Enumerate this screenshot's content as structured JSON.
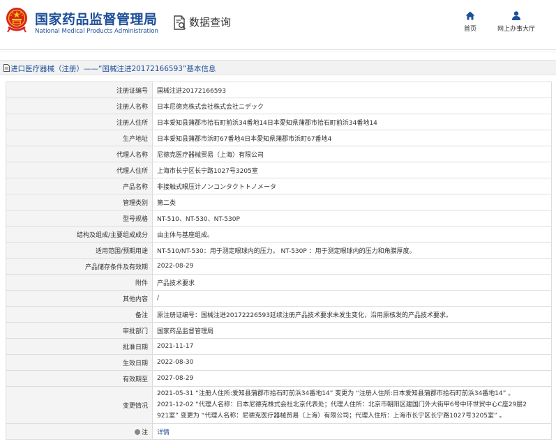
{
  "header": {
    "brand_cn": "国家药品监督管理局",
    "brand_en": "National Medical Products Administration",
    "query_title": "数据查询",
    "nav": [
      {
        "label": "首页",
        "icon": "home-icon"
      },
      {
        "label": "网上办事大厅",
        "icon": "person-icon"
      }
    ]
  },
  "page_title": "进口医疗器械（注册）——“国械注进20172166593”基本信息",
  "rows": [
    {
      "label": "注册证编号",
      "value": "国械注进20172166593"
    },
    {
      "label": "注册人名称",
      "value": "日本尼德克株式会社株式会社ニデック"
    },
    {
      "label": "注册人住所",
      "value": "日本爱知县蒲郡市拾石町前浜34番地14日本愛知県蒲郡市拾石町前浜34番地14"
    },
    {
      "label": "生产地址",
      "value": "日本爱知县蒲郡市浜町67番地4日本愛知県蒲郡市浜町67番地4"
    },
    {
      "label": "代理人名称",
      "value": "尼德克医疗器械贸易（上海）有限公司"
    },
    {
      "label": "代理人住所",
      "value": "上海市长宁区长宁路1027号3205室"
    },
    {
      "label": "产品名称",
      "value": "非接触式眼压计ノンコンタクトトノメータ"
    },
    {
      "label": "管理类别",
      "value": "第二类"
    },
    {
      "label": "型号规格",
      "value": "NT-510、NT-530、NT-530P"
    },
    {
      "label": "结构及组成/主要组成成分",
      "value": "由主体与基座组成。"
    },
    {
      "label": "适用范围/预期用途",
      "value": "NT-510/NT-530：用于测定眼球内的压力。 NT-530P ：用于测定眼球内的压力和角膜厚度。"
    },
    {
      "label": "产品储存条件及有效期",
      "value": "2022-08-29"
    },
    {
      "label": "附件",
      "value": "产品技术要求"
    },
    {
      "label": "其他内容",
      "value": "/"
    },
    {
      "label": "备注",
      "value": "原注册证编号：国械注进20172226593延续注册产品技术要求未发生变化，沿用原核发的产品技术要求。"
    },
    {
      "label": "审批部门",
      "value": "国家药品监督管理局"
    },
    {
      "label": "批准日期",
      "value": "2021-11-17"
    },
    {
      "label": "生效日期",
      "value": "2022-08-30"
    },
    {
      "label": "有效期至",
      "value": "2027-08-29"
    }
  ],
  "change_row": {
    "label": "变更情况",
    "lines": [
      "2021-05-31 “注册人住所:爱知县蒲郡市拾石町前浜34番地14” 变更为 “注册人住所:日本爱知县蒲郡市拾石町前浜34番地14” 。",
      "2021-12-02 “代理人名称：日本尼德克株式会社北京代表处；代理人住所：北京市朝阳区建国门外大街甲6号中环世贸中心C座29层2",
      "921室” 变更为 “代理人名称：尼德克医疗器械贸易（上海）有限公司；代理人住所：上海市长宁区长宁路1027号3205室” 。"
    ]
  },
  "note_row": {
    "label": "注",
    "link": "详情"
  }
}
